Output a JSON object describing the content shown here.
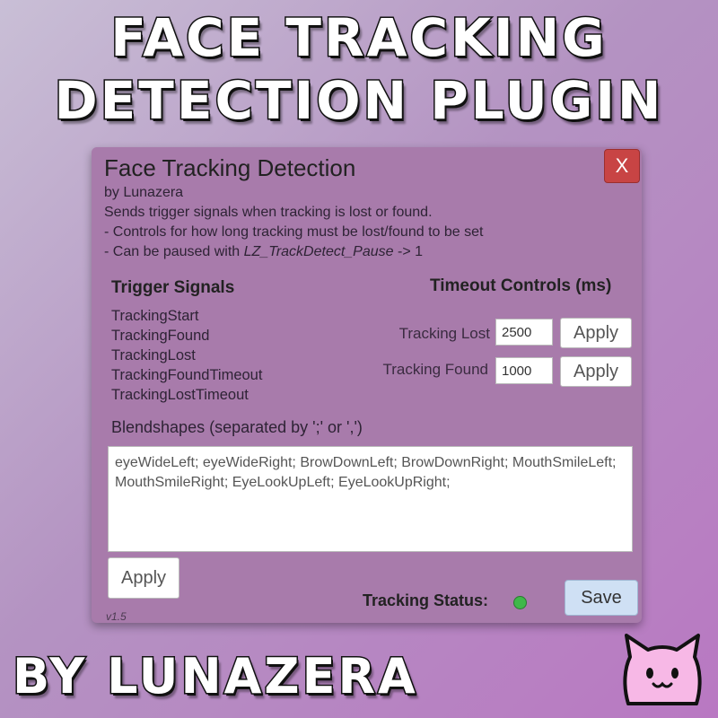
{
  "banner": {
    "line1": "FACE TRACKING",
    "line2": "DETECTION PLUGIN",
    "byline": "BY LUNAZERA"
  },
  "window": {
    "title": "Face Tracking Detection",
    "close_label": "X",
    "author": "by Lunazera",
    "desc_line1": "Sends trigger signals when tracking is lost or found.",
    "desc_line2": "- Controls for how long tracking must be lost/found to be set",
    "desc_line3_prefix": "- Can be paused with ",
    "desc_line3_param": "LZ_TrackDetect_Pause",
    "desc_line3_suffix": " -> 1",
    "version": "v1.5"
  },
  "trigger_signals": {
    "heading": "Trigger Signals",
    "items": [
      "TrackingStart",
      "TrackingFound",
      "TrackingLost",
      "TrackingFoundTimeout",
      "TrackingLostTimeout"
    ]
  },
  "timeout_controls": {
    "heading": "Timeout Controls (ms)",
    "lost_label": "Tracking Lost",
    "lost_value": "2500",
    "found_label": "Tracking Found",
    "found_value": "1000",
    "apply_label": "Apply"
  },
  "blendshapes": {
    "label": "Blendshapes (separated by ';' or ',')",
    "value": "eyeWideLeft; eyeWideRight; BrowDownLeft; BrowDownRight; MouthSmileLeft; MouthSmileRight; EyeLookUpLeft; EyeLookUpRight;",
    "apply_label": "Apply"
  },
  "status": {
    "label": "Tracking Status:",
    "indicator_color": "#3fb84a"
  },
  "save_label": "Save",
  "icons": {
    "close": "close-icon",
    "status": "status-dot-icon",
    "mascot": "cat-face-icon"
  }
}
